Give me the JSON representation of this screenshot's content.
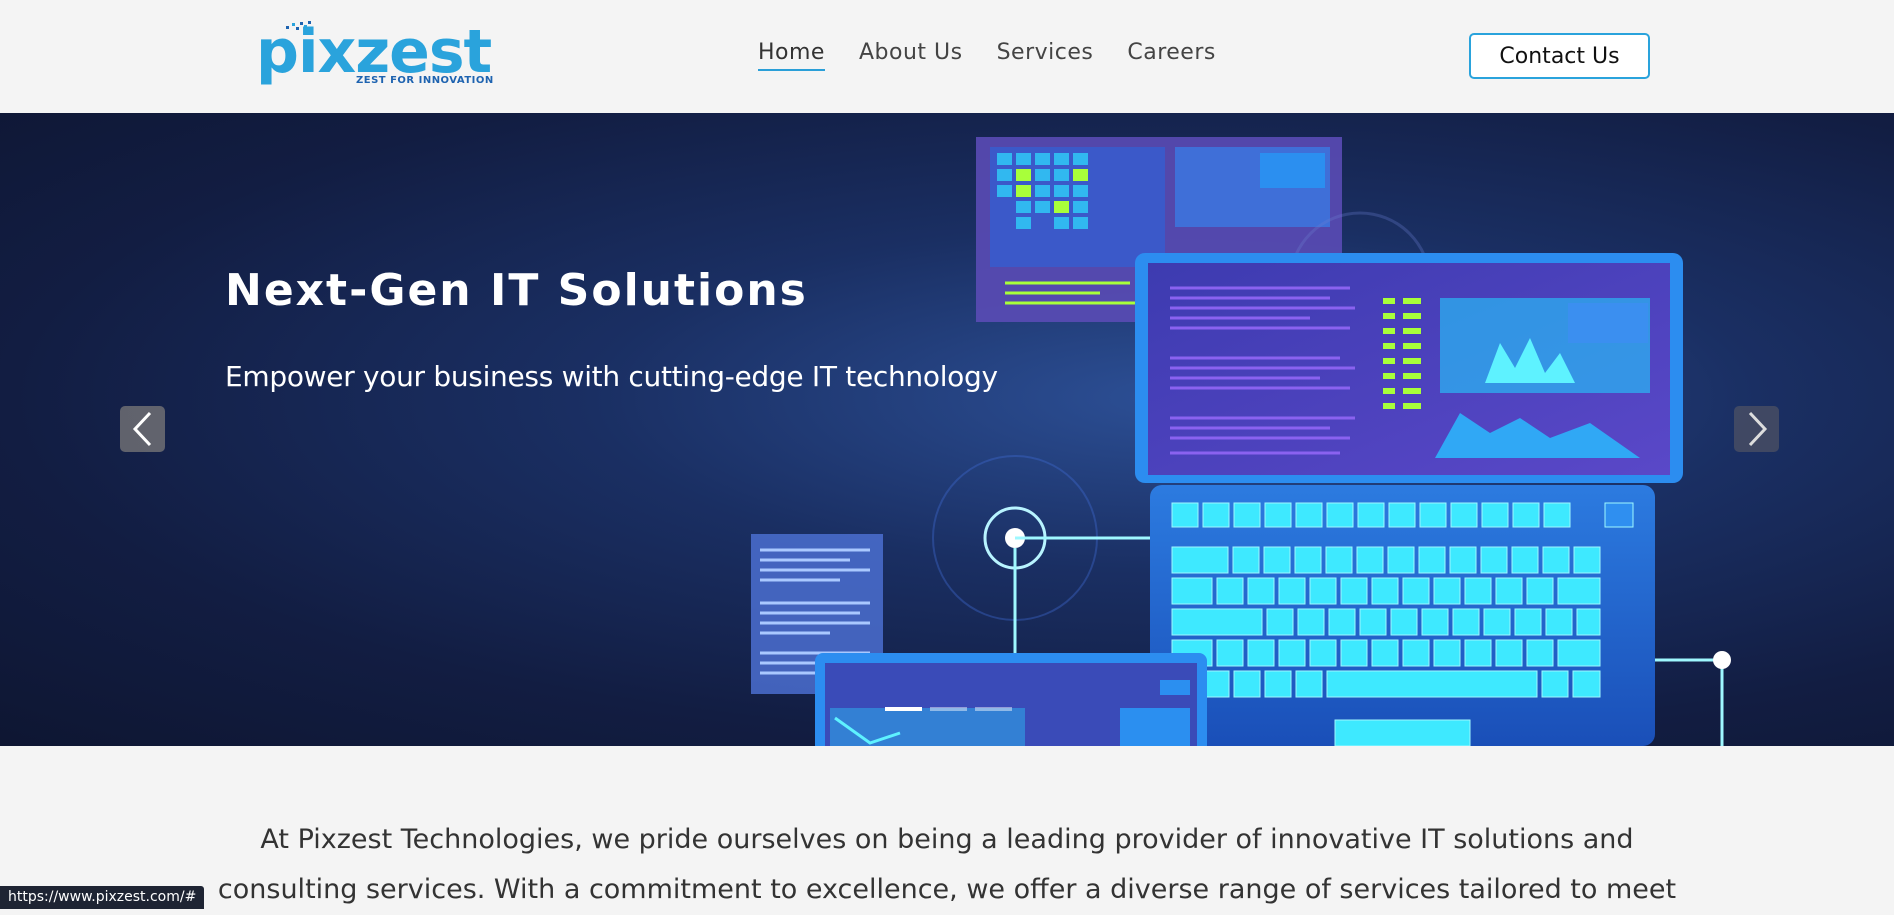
{
  "brand": {
    "name": "pixzest",
    "tagline": "ZEST FOR INNOVATION",
    "primary_color": "#2aa3dc",
    "tagline_color": "#1e63b0"
  },
  "nav": {
    "items": [
      {
        "label": "Home",
        "active": true
      },
      {
        "label": "About Us",
        "active": false
      },
      {
        "label": "Services",
        "active": false
      },
      {
        "label": "Careers",
        "active": false
      }
    ]
  },
  "header": {
    "contact_label": "Contact Us"
  },
  "hero": {
    "title": "Next-Gen IT Solutions",
    "subtitle": "Empower your business with cutting-edge IT technology",
    "prev_icon": "chevron-left-icon",
    "next_icon": "chevron-right-icon",
    "slides": 3,
    "active_slide": 1
  },
  "intro": {
    "text": "At Pixzest Technologies, we pride ourselves on being a leading provider of innovative IT solutions and consulting services. With a commitment to excellence, we offer a diverse range of services tailored to meet"
  },
  "status_bar": {
    "url": "https://www.pixzest.com/#"
  }
}
